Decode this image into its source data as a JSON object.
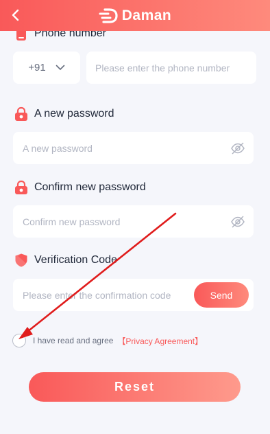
{
  "header": {
    "brand": "Daman",
    "back_icon": "chevron-left-icon"
  },
  "phone": {
    "label": "Phone number",
    "country_code": "+91",
    "placeholder": "Please enter the phone number"
  },
  "new_password": {
    "label": "A new password",
    "placeholder": "A new password"
  },
  "confirm_password": {
    "label": "Confirm new password",
    "placeholder": "Confirm new password"
  },
  "verification": {
    "label": "Verification Code",
    "placeholder": "Please enter the confirmation code",
    "send_label": "Send"
  },
  "agreement": {
    "text": "I have read and agree",
    "link": "【Privacy Agreement】",
    "checked": false
  },
  "reset_label": "Reset",
  "colors": {
    "accent": "#f95959",
    "accent_light": "#fe8a7c",
    "background": "#f5f6fb",
    "annotation_arrow": "#e01c1c"
  }
}
